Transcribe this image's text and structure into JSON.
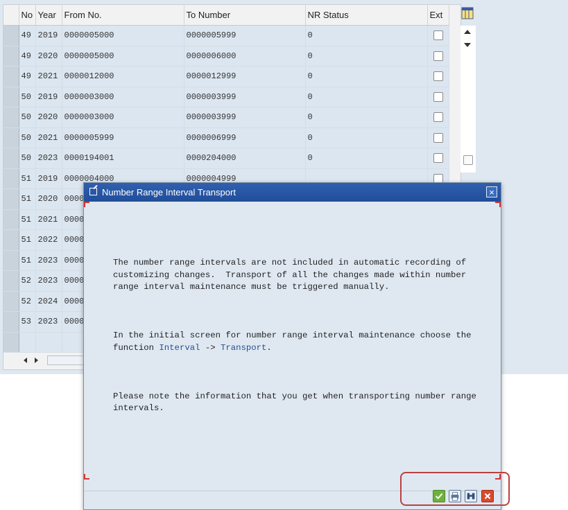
{
  "table": {
    "headers": [
      "No",
      "Year",
      "From No.",
      "To Number",
      "NR Status",
      "Ext"
    ],
    "rows": [
      {
        "no": "49",
        "year": "2019",
        "from": "0000005000",
        "to": "0000005999",
        "status": "0"
      },
      {
        "no": "49",
        "year": "2020",
        "from": "0000005000",
        "to": "0000006000",
        "status": "0"
      },
      {
        "no": "49",
        "year": "2021",
        "from": "0000012000",
        "to": "0000012999",
        "status": "0"
      },
      {
        "no": "50",
        "year": "2019",
        "from": "0000003000",
        "to": "0000003999",
        "status": "0"
      },
      {
        "no": "50",
        "year": "2020",
        "from": "0000003000",
        "to": "0000003999",
        "status": "0"
      },
      {
        "no": "50",
        "year": "2021",
        "from": "0000005999",
        "to": "0000006999",
        "status": "0"
      },
      {
        "no": "50",
        "year": "2023",
        "from": "0000194001",
        "to": "0000204000",
        "status": "0"
      },
      {
        "no": "51",
        "year": "2019",
        "from": "0000004000",
        "to": "0000004999",
        "status": ""
      },
      {
        "no": "51",
        "year": "2020",
        "from": "0000",
        "to": "",
        "status": ""
      },
      {
        "no": "51",
        "year": "2021",
        "from": "0000",
        "to": "",
        "status": ""
      },
      {
        "no": "51",
        "year": "2022",
        "from": "0000",
        "to": "",
        "status": ""
      },
      {
        "no": "51",
        "year": "2023",
        "from": "0000",
        "to": "",
        "status": ""
      },
      {
        "no": "52",
        "year": "2023",
        "from": "0000",
        "to": "",
        "status": ""
      },
      {
        "no": "52",
        "year": "2024",
        "from": "0000",
        "to": "",
        "status": ""
      },
      {
        "no": "53",
        "year": "2023",
        "from": "0000",
        "to": "",
        "status": ""
      }
    ]
  },
  "dialog": {
    "title": "Number Range Interval Transport",
    "close_label": "×",
    "paragraph1": "The number range intervals are not included in automatic recording of\ncustomizing changes.  Transport of all the changes made within number\nrange interval maintenance must be triggered manually.",
    "paragraph2_prefix": "In the initial screen for number range interval maintenance choose the\nfunction ",
    "paragraph2_link1": "Interval",
    "paragraph2_arrow": " -> ",
    "paragraph2_link2": "Transport",
    "paragraph2_suffix": ".",
    "paragraph3": "Please note the information that you get when transporting number range\nintervals."
  },
  "icons": {
    "column_settings": "column-settings-icon",
    "continue": "checkmark-icon",
    "print": "print-icon",
    "find": "binoculars-icon",
    "cancel": "cancel-icon"
  },
  "colors": {
    "title_bar": "#214e9a",
    "ok_button": "#6fb23b",
    "cancel_button": "#d94a2c",
    "highlight": "#b9413f"
  }
}
